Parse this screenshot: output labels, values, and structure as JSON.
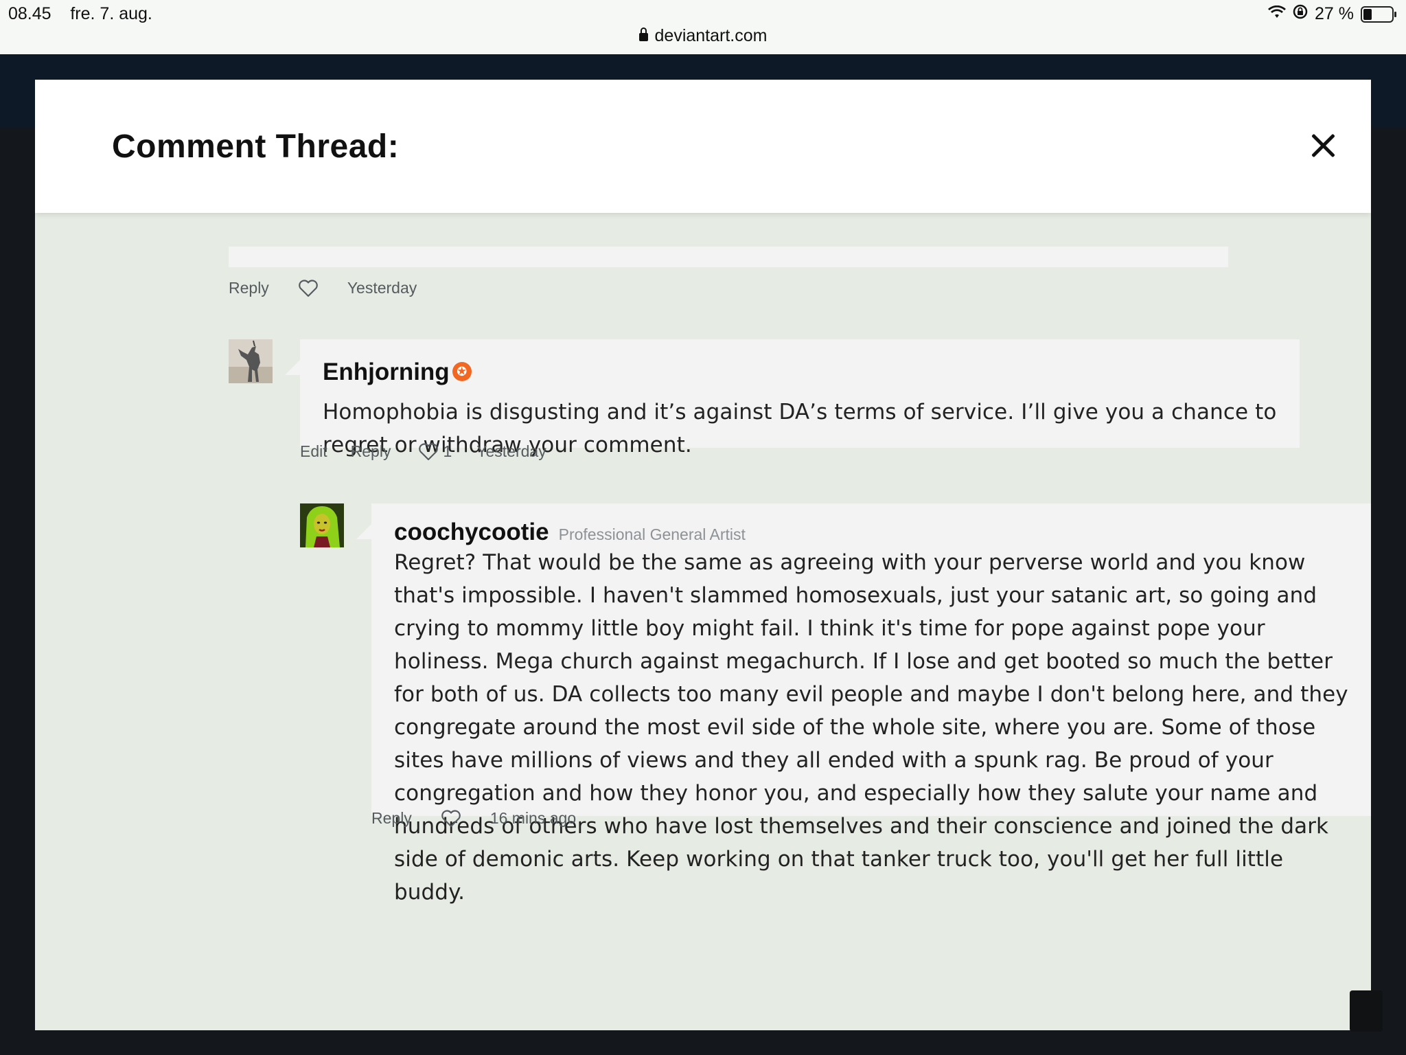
{
  "status_bar": {
    "time": "08.45",
    "date": "fre. 7. aug.",
    "battery": "27 %",
    "url": "deviantart.com"
  },
  "modal": {
    "title": "Comment Thread:",
    "close_icon": "close-icon"
  },
  "thread": {
    "top_actions": {
      "reply": "Reply",
      "time": "Yesterday"
    },
    "comments": [
      {
        "username": "Enhjorning",
        "badge": "core-member-badge",
        "text": "Homophobia is disgusting and it’s against DA’s terms of service. I’ll give you a chance to regret or withdraw your comment.",
        "actions": {
          "edit": "Edit",
          "reply": "Reply",
          "likes": "1",
          "time": "Yesterday"
        }
      },
      {
        "username": "coochycootie",
        "user_title": "Professional General Artist",
        "text": "Regret? That would be the same as agreeing with your perverse world and you know that's impossible. I haven't slammed homosexuals, just your satanic art, so going and crying to mommy little boy might fail. I think it's time for pope against pope your holiness. Mega church against megachurch.  If I lose and get booted so much the better for both of us. DA collects too many evil people and maybe I don't belong here, and they congregate around the most evil side of the whole site, where you are. Some of those sites have millions of views and they all ended with a spunk rag.  Be proud of your congregation and how they honor you, and especially how they salute your name and hundreds of others who have lost themselves and their conscience and joined the dark side of demonic arts. Keep working on that tanker truck too, you'll get her full little buddy.",
        "actions": {
          "reply": "Reply",
          "time": "16 mins ago"
        }
      }
    ]
  },
  "colors": {
    "modal_bg": "#e6ece4",
    "bubble_bg": "#f2f3f2",
    "badge": "#f26722"
  }
}
